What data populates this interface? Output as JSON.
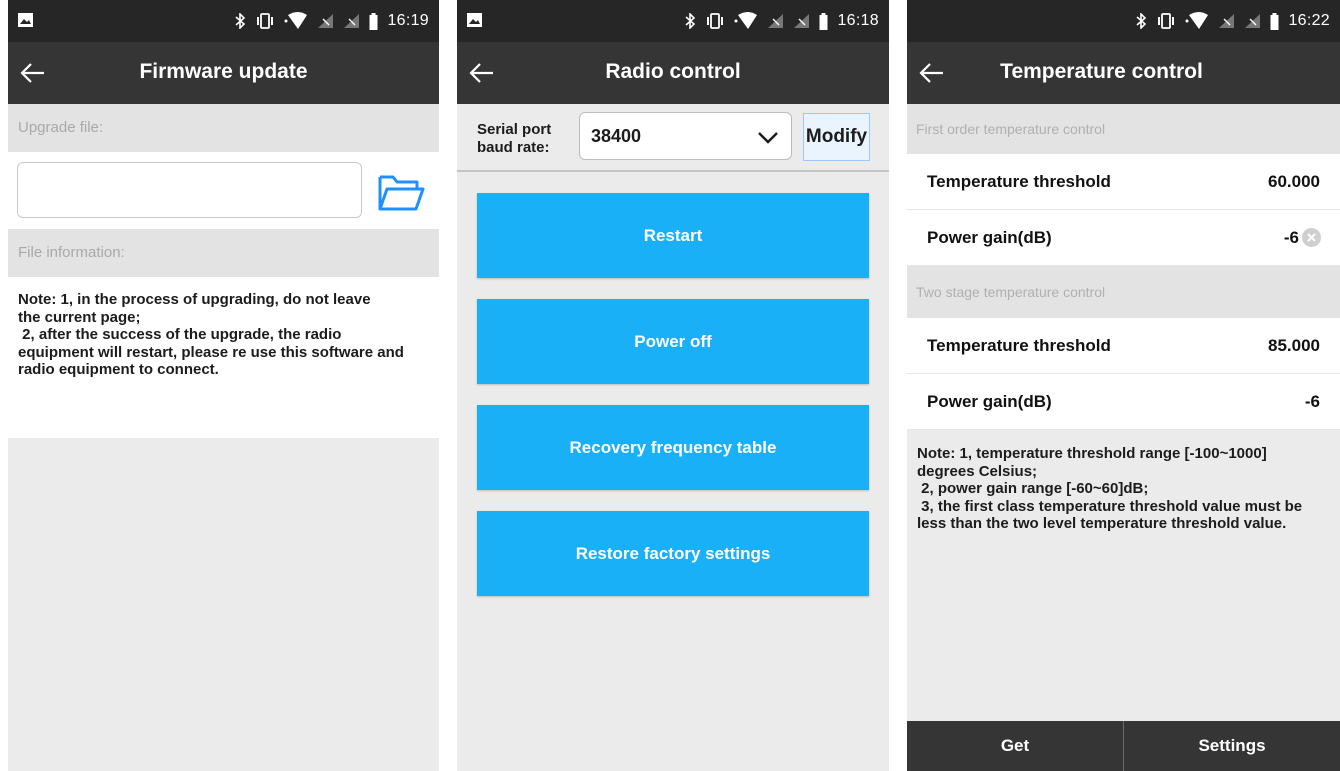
{
  "firmware": {
    "time": "16:19",
    "title": "Firmware update",
    "upgrade_file_label": "Upgrade file:",
    "upgrade_file_value": "",
    "file_info_label": "File information:",
    "note": "Note: 1, in the process of upgrading, do not leave\nthe current page;\n 2, after the success of the upgrade, the radio\nequipment will restart, please re use this software and\nradio equipment to connect."
  },
  "radio": {
    "time": "16:18",
    "title": "Radio control",
    "baud_label": "Serial port\nbaud rate:",
    "baud_value": "38400",
    "modify_label": "Modify",
    "buttons": [
      "Restart",
      "Power off",
      "Recovery frequency table",
      "Restore factory settings"
    ]
  },
  "temperature": {
    "time": "16:22",
    "title": "Temperature control",
    "first_section": "First order temperature control",
    "first_threshold_label": "Temperature threshold",
    "first_threshold_value": "60.000",
    "first_gain_label": "Power gain(dB)",
    "first_gain_value": "-6",
    "second_section": "Two stage temperature control",
    "second_threshold_label": "Temperature threshold",
    "second_threshold_value": "85.000",
    "second_gain_label": "Power gain(dB)",
    "second_gain_value": "-6",
    "note": "Note: 1, temperature threshold range [-100~1000]\ndegrees Celsius;\n 2, power gain range [-60~60]dB;\n 3, the first class temperature threshold value must be\nless than the two level temperature threshold value.",
    "get_label": "Get",
    "settings_label": "Settings"
  },
  "icons": {
    "status": [
      "image-icon",
      "bluetooth-icon",
      "vibrate-icon",
      "wifi-icon",
      "no-signal-icon",
      "battery-icon"
    ],
    "back": "back-arrow-icon",
    "folder": "folder-icon",
    "dropdown": "chevron-down-icon",
    "clear": "clear-icon"
  },
  "colors": {
    "statusbar": "#262626",
    "titlebar": "#353535",
    "accent_button": "#19b0f7",
    "folder_icon": "#1e90ff",
    "section_background": "#e3e3e3"
  }
}
